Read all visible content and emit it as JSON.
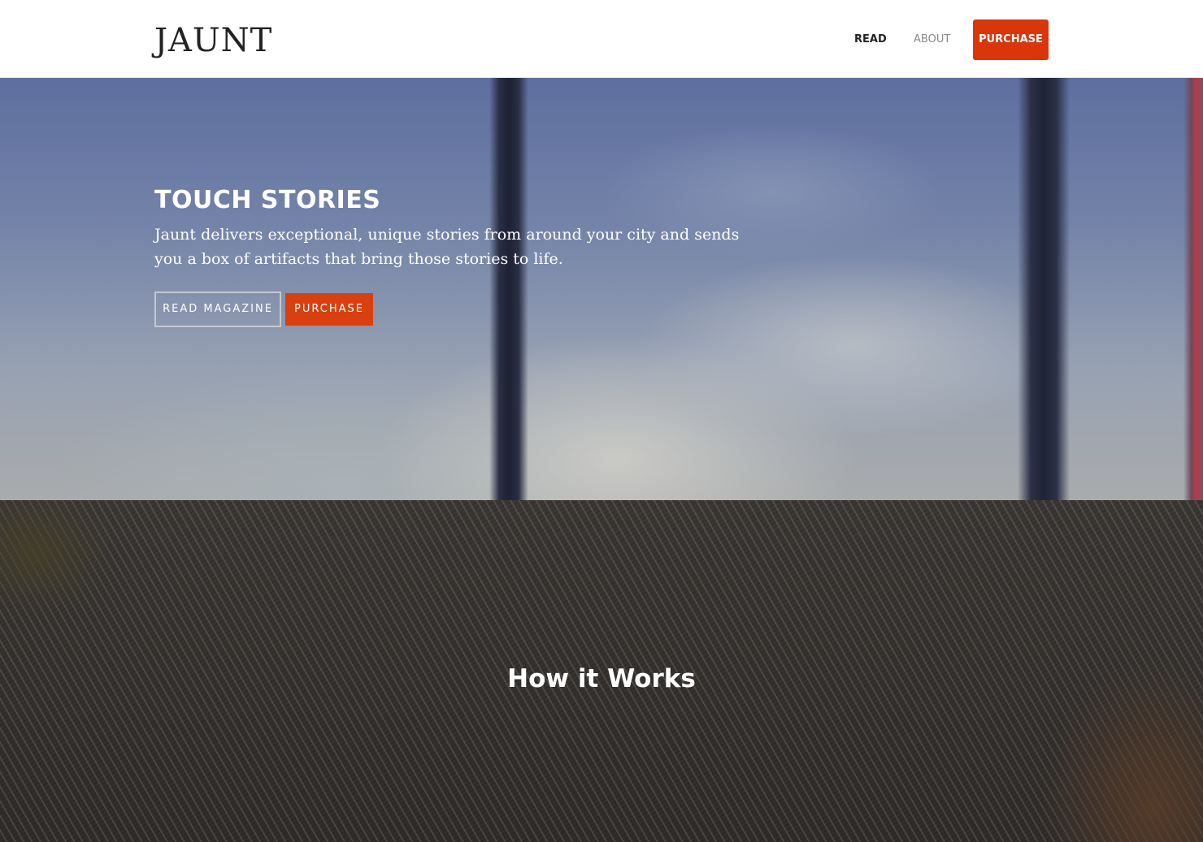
{
  "header": {
    "logo": "JAUNT",
    "nav": {
      "read": "READ",
      "about": "ABOUT",
      "purchase": "PURCHASE"
    }
  },
  "hero": {
    "title": "TOUCH STORIES",
    "text": "Jaunt delivers exceptional, unique stories from around your city and sends you a box of artifacts that bring those stories to life.",
    "buttons": {
      "read_magazine": "READ MAGAZINE",
      "purchase": "PURCHASE"
    }
  },
  "how_it_works": {
    "title": "How it Works"
  },
  "colors": {
    "accent": "#d9360b",
    "text_dark": "#222222",
    "text_muted": "#888888"
  }
}
